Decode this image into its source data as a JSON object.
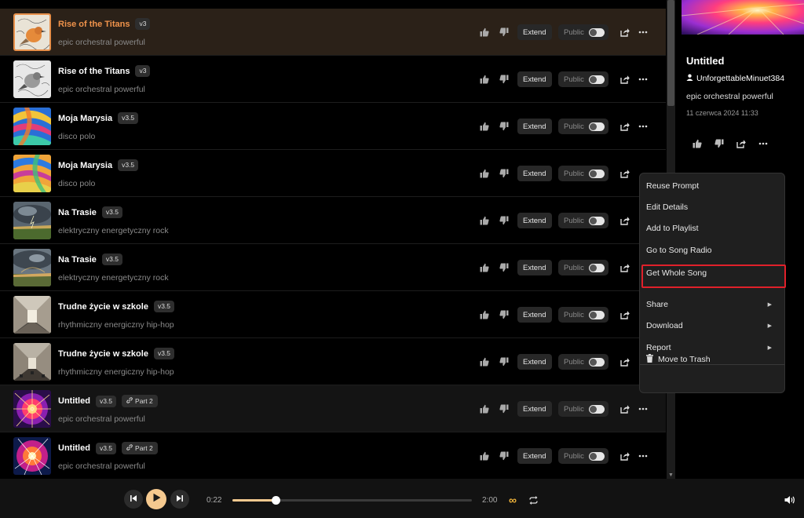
{
  "songs": [
    {
      "title": "Rise of the Titans",
      "version": "v3",
      "desc": "epic orchestral powerful",
      "extend": "Extend",
      "public": "Public",
      "state": "active",
      "art": "bird-orange"
    },
    {
      "title": "Rise of the Titans",
      "version": "v3",
      "desc": "epic orchestral powerful",
      "extend": "Extend",
      "public": "Public",
      "state": "",
      "art": "bird-gray"
    },
    {
      "title": "Moja Marysia",
      "version": "v3.5",
      "desc": "disco polo",
      "extend": "Extend",
      "public": "Public",
      "state": "",
      "art": "swirl"
    },
    {
      "title": "Moja Marysia",
      "version": "v3.5",
      "desc": "disco polo",
      "extend": "Extend",
      "public": "Public",
      "state": "",
      "art": "swirl2"
    },
    {
      "title": "Na Trasie",
      "version": "v3.5",
      "desc": "elektryczny energetyczny rock",
      "extend": "Extend",
      "public": "Public",
      "state": "",
      "art": "storm"
    },
    {
      "title": "Na Trasie",
      "version": "v3.5",
      "desc": "elektryczny energetyczny rock",
      "extend": "Extend",
      "public": "Public",
      "state": "",
      "art": "storm2"
    },
    {
      "title": "Trudne życie w szkole",
      "version": "v3.5",
      "desc": "rhythmiczny energiczny hip-hop",
      "extend": "Extend",
      "public": "Public",
      "state": "",
      "art": "hall"
    },
    {
      "title": "Trudne życie w szkole",
      "version": "v3.5",
      "desc": "rhythmiczny energiczny hip-hop",
      "extend": "Extend",
      "public": "Public",
      "state": "",
      "art": "hall2"
    },
    {
      "title": "Untitled",
      "version": "v3.5",
      "part": "Part 2",
      "desc": "epic orchestral powerful",
      "extend": "Extend",
      "public": "Public",
      "state": "sel",
      "art": "burst"
    },
    {
      "title": "Untitled",
      "version": "v3.5",
      "part": "Part 2",
      "desc": "epic orchestral powerful",
      "extend": "Extend",
      "public": "Public",
      "state": "",
      "art": "burst2"
    }
  ],
  "panel": {
    "title": "Untitled",
    "user": "UnforgettableMinuet384",
    "desc": "epic orchestral powerful",
    "date": "11 czerwca 2024 11:33"
  },
  "menu": {
    "items": [
      {
        "label": "Reuse Prompt",
        "submenu": false
      },
      {
        "label": "Edit Details",
        "submenu": false
      },
      {
        "label": "Add to Playlist",
        "submenu": false
      },
      {
        "label": "Go to Song Radio",
        "submenu": false
      },
      {
        "label": "Get Whole Song",
        "submenu": false,
        "highlighted": true
      },
      {
        "label": "Share",
        "submenu": true
      },
      {
        "label": "Download",
        "submenu": true
      },
      {
        "label": "Report",
        "submenu": true
      }
    ],
    "trash_label": "Move to Trash"
  },
  "player": {
    "current_time": "0:22",
    "total_time": "2:00",
    "progress": 0.18
  },
  "colors": {
    "accent": "#f0934b",
    "progress": "#f3c98f",
    "loop": "#f4b73c",
    "highlight_border": "#e0202a"
  }
}
